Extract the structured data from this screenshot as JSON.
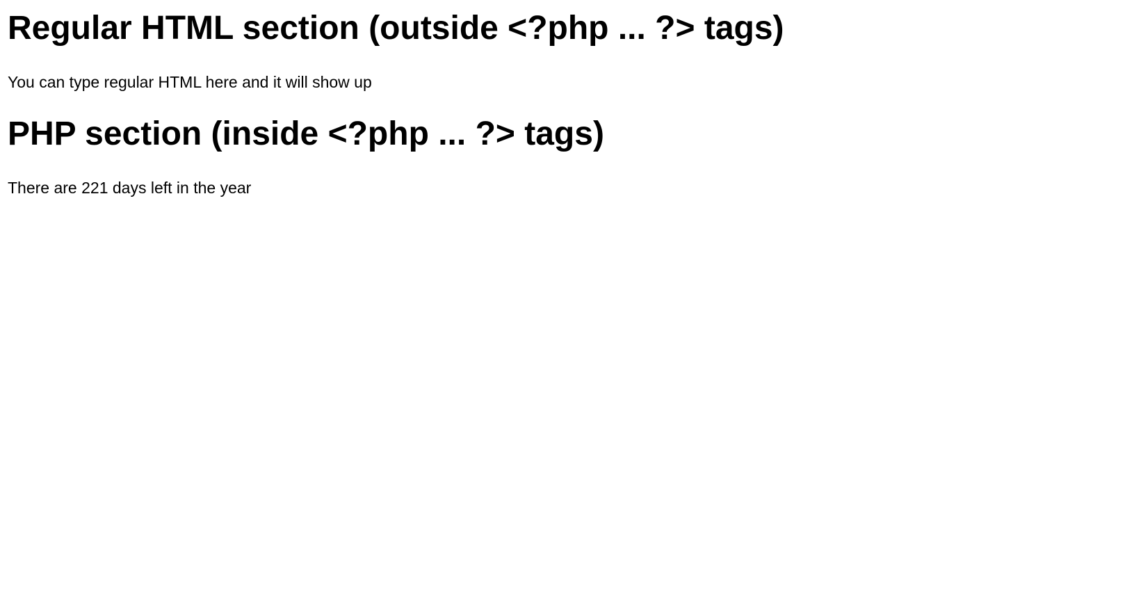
{
  "sections": [
    {
      "heading": "Regular HTML section (outside <?php ... ?> tags)",
      "text": "You can type regular HTML here and it will show up"
    },
    {
      "heading": "PHP section (inside <?php ... ?> tags)",
      "text": "There are 221 days left in the year"
    }
  ]
}
